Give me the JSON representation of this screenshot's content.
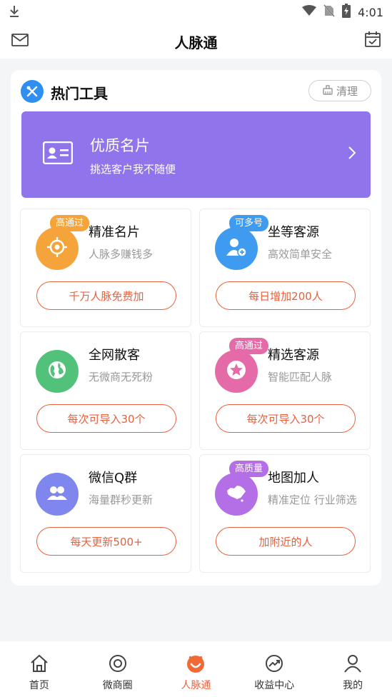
{
  "status_bar": {
    "time": "4:01"
  },
  "app_bar": {
    "title": "人脉通"
  },
  "section": {
    "title": "热门工具",
    "clean_label": "清理"
  },
  "banner": {
    "title": "优质名片",
    "subtitle": "挑选客户我不随便"
  },
  "tools": [
    {
      "title": "精准名片",
      "subtitle": "人脉多赚钱多",
      "badge": "高通过",
      "action": "千万人脉免费加",
      "icon": "target-icon",
      "color": "#f4a43a",
      "badge_color": "#f4a43a"
    },
    {
      "title": "坐等客源",
      "subtitle": "高效简单安全",
      "badge": "可多号",
      "action": "每日增加200人",
      "icon": "add-user-icon",
      "color": "#3e9bf0",
      "badge_color": "#3e9bf0"
    },
    {
      "title": "全网散客",
      "subtitle": "无微商无死粉",
      "badge": "",
      "action": "每次可导入30个",
      "icon": "globe-icon",
      "color": "#52c27a",
      "badge_color": ""
    },
    {
      "title": "精选客源",
      "subtitle": "智能匹配人脉",
      "badge": "高通过",
      "action": "每次可导入30个",
      "icon": "star-icon",
      "color": "#e56aa8",
      "badge_color": "#e56aa8"
    },
    {
      "title": "微信Q群",
      "subtitle": "海量群秒更新",
      "badge": "",
      "action": "每天更新500+",
      "icon": "group-icon",
      "color": "#7f86ee",
      "badge_color": ""
    },
    {
      "title": "地图加人",
      "subtitle": "精准定位 行业筛选",
      "badge": "高质量",
      "action": "加附近的人",
      "icon": "map-icon",
      "color": "#b46ee6",
      "badge_color": "#b46ee6"
    }
  ],
  "tab_bar": {
    "items": [
      {
        "label": "首页",
        "icon": "home-icon"
      },
      {
        "label": "微商圈",
        "icon": "circle-icon"
      },
      {
        "label": "人脉通",
        "icon": "smile-icon",
        "active": true
      },
      {
        "label": "收益中心",
        "icon": "trend-icon"
      },
      {
        "label": "我的",
        "icon": "person-icon"
      }
    ]
  }
}
